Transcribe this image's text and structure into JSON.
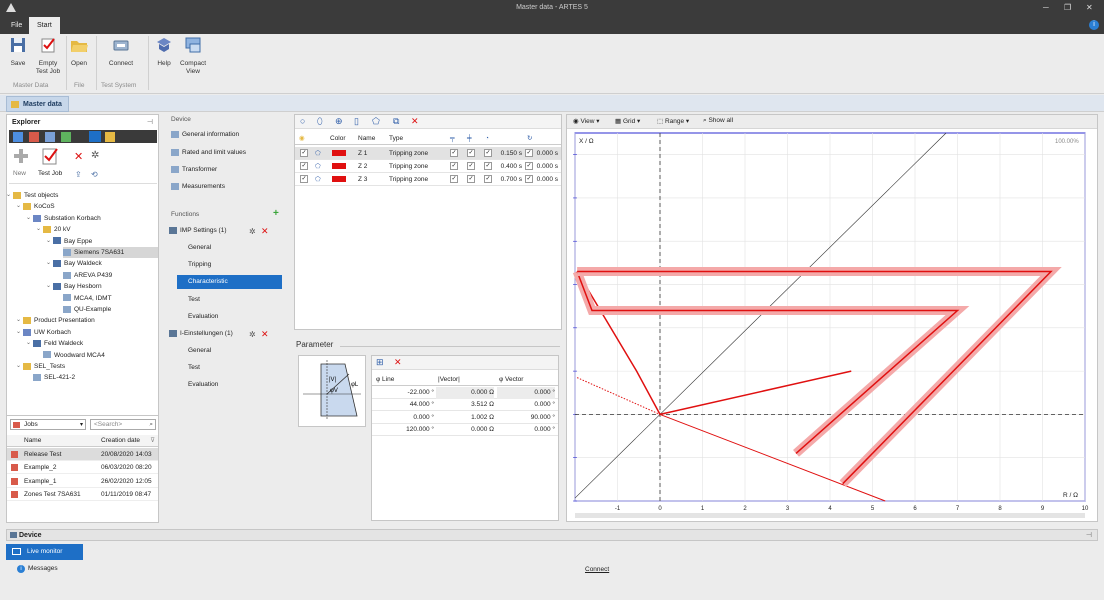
{
  "app": {
    "title": "Master data - ARTES 5"
  },
  "menu": {
    "tabs": [
      {
        "label": "File"
      },
      {
        "label": "Start"
      }
    ]
  },
  "ribbon": {
    "buttons": [
      {
        "label1": "Save",
        "label2": "",
        "icon": "save-icon"
      },
      {
        "label1": "Empty",
        "label2": "Test Job",
        "icon": "test-job-icon"
      },
      {
        "label1": "Open",
        "label2": "",
        "icon": "folder-open-icon"
      },
      {
        "label1": "Connect",
        "label2": "",
        "icon": "connect-icon"
      },
      {
        "label1": "Help",
        "label2": "",
        "icon": "help-icon"
      },
      {
        "label1": "Compact",
        "label2": "View",
        "icon": "compact-view-icon"
      }
    ],
    "groups": [
      "Master Data",
      "File",
      "Test System"
    ]
  },
  "doc_tab": {
    "label": "Master data"
  },
  "explorer": {
    "title": "Explorer",
    "new_label": "New",
    "testjob_label": "Test Job",
    "tree": [
      {
        "label": "Test objects",
        "level": 0,
        "icon": "folder"
      },
      {
        "label": "KoCoS",
        "level": 1,
        "icon": "folder"
      },
      {
        "label": "Substation Korbach",
        "level": 2,
        "icon": "substation"
      },
      {
        "label": "20 kV",
        "level": 3,
        "icon": "voltage"
      },
      {
        "label": "Bay Eppe",
        "level": 4,
        "icon": "bay"
      },
      {
        "label": "Siemens 7SA631",
        "level": 5,
        "icon": "relay",
        "selected": true
      },
      {
        "label": "Bay Waldeck",
        "level": 4,
        "icon": "bay"
      },
      {
        "label": "AREVA P439",
        "level": 5,
        "icon": "relay"
      },
      {
        "label": "Bay Hesborn",
        "level": 4,
        "icon": "bay"
      },
      {
        "label": "MCA4, IDMT",
        "level": 5,
        "icon": "relay"
      },
      {
        "label": "QU-Example",
        "level": 5,
        "icon": "relay"
      },
      {
        "label": "Product Presentation",
        "level": 1,
        "icon": "folder"
      },
      {
        "label": "UW Korbach",
        "level": 1,
        "icon": "substation"
      },
      {
        "label": "Feld Waldeck",
        "level": 2,
        "icon": "bay"
      },
      {
        "label": "Woodward MCA4",
        "level": 3,
        "icon": "relay"
      },
      {
        "label": "SEL_Tests",
        "level": 1,
        "icon": "folder"
      },
      {
        "label": "SEL-421-2",
        "level": 2,
        "icon": "relay"
      }
    ]
  },
  "jobs": {
    "dropdown": "Jobs",
    "search_placeholder": "<Search>",
    "col_name": "Name",
    "col_date": "Creation date",
    "rows": [
      {
        "name": "Release Test",
        "date": "20/08/2020 14:03",
        "selected": true
      },
      {
        "name": "Example_2",
        "date": "06/03/2020 08:20"
      },
      {
        "name": "Example_1",
        "date": "26/02/2020 12:05"
      },
      {
        "name": "Zones Test 7SA631",
        "date": "01/11/2019 08:47"
      }
    ]
  },
  "functions": {
    "device_heading": "Device",
    "device_items": [
      "General information",
      "Rated and limit values",
      "Transformer",
      "Measurements"
    ],
    "functions_heading": "Functions",
    "imp_title": "IMP Settings (1)",
    "imp_items": [
      "General",
      "Tripping",
      "Characteristic",
      "Test",
      "Evaluation"
    ],
    "i_title": "I-Einstellungen (1)",
    "i_items": [
      "General",
      "Test",
      "Evaluation"
    ]
  },
  "zones": {
    "headers": {
      "color": "Color",
      "name": "Name",
      "type": "Type"
    },
    "rows": [
      {
        "name": "Z 1",
        "type": "Tripping zone",
        "time1": "0.150 s",
        "time2": "0.000 s"
      },
      {
        "name": "Z 2",
        "type": "Tripping zone",
        "time1": "0.400 s",
        "time2": "0.000 s"
      },
      {
        "name": "Z 3",
        "type": "Tripping zone",
        "time1": "0.700 s",
        "time2": "0.000 s"
      }
    ],
    "zone_color": "#e01010"
  },
  "parameter": {
    "label": "Parameter",
    "diagram_labels": {
      "v": "|V|",
      "phi_l": "φL",
      "phi_v": "φV"
    },
    "headers": {
      "line": "φ Line",
      "vector": "|Vector|",
      "phi_vector": "φ Vector"
    },
    "rows": [
      {
        "line": "-22.000 °",
        "vector": "0.000 Ω",
        "phi": "0.000 °"
      },
      {
        "line": "44.000 °",
        "vector": "3.512 Ω",
        "phi": "0.000 °"
      },
      {
        "line": "0.000 °",
        "vector": "1.002 Ω",
        "phi": "90.000 °"
      },
      {
        "line": "120.000 °",
        "vector": "0.000 Ω",
        "phi": "0.000 °"
      }
    ]
  },
  "chart_toolbar": {
    "view": "View",
    "grid": "Grid",
    "range": "Range",
    "show_all": "Show all"
  },
  "chart_data": {
    "type": "line",
    "title": "",
    "ylabel": "X / Ω",
    "xlabel": "R / Ω",
    "zoom": "100.00%",
    "xlim": [
      -2,
      10
    ],
    "ylim": [
      -2,
      6.5
    ],
    "x_ticks": [
      "-1",
      "0",
      "1",
      "2",
      "3",
      "4",
      "5",
      "6",
      "7",
      "8",
      "9",
      "10"
    ],
    "series": [
      {
        "name": "Z 1",
        "points": [
          [
            -1.95,
            3.3
          ],
          [
            -0.55,
            1.0
          ],
          [
            0,
            0
          ],
          [
            4.5,
            1.0
          ]
        ]
      },
      {
        "name": "Z 2",
        "points": [
          [
            -1.95,
            3.3
          ],
          [
            -1.6,
            2.4
          ],
          [
            7,
            2.4
          ],
          [
            3.2,
            -0.9
          ]
        ]
      },
      {
        "name": "Z 3",
        "points": [
          [
            -1.95,
            3.3
          ],
          [
            9.2,
            3.3
          ],
          [
            4.3,
            -1.6
          ]
        ]
      }
    ],
    "line_angle_deg": 44,
    "colors": {
      "zone": "#e01010",
      "band": "#f4a9a9"
    }
  },
  "device_bar": {
    "title": "Device",
    "live_monitor": "Live monitor",
    "messages": "Messages",
    "connect": "Connect"
  }
}
